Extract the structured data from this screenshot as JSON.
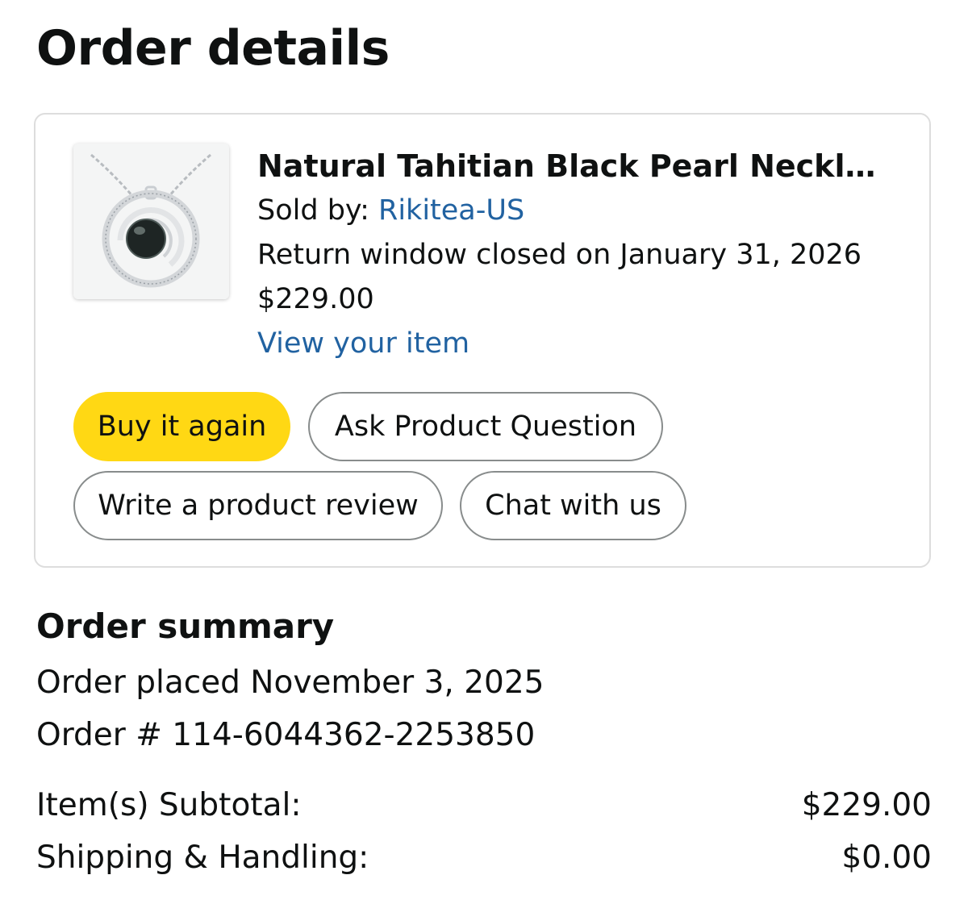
{
  "page": {
    "title": "Order details"
  },
  "item": {
    "title": "Natural Tahitian Black Pearl Necklac…",
    "sold_by_label": "Sold by:",
    "seller": "Rikitea-US",
    "return_window": "Return window closed on January 31, 2026",
    "price": "$229.00",
    "view_link": "View your item",
    "image_icon": "pearl-pendant-necklace"
  },
  "actions": {
    "buy_again": "Buy it again",
    "ask_question": "Ask Product Question",
    "write_review": "Write a product review",
    "chat": "Chat with us"
  },
  "summary": {
    "title": "Order summary",
    "placed": "Order placed November 3, 2025",
    "order_number": "Order # 114-6044362-2253850",
    "rows": [
      {
        "label": "Item(s) Subtotal:",
        "value": "$229.00"
      },
      {
        "label": "Shipping & Handling:",
        "value": "$0.00"
      }
    ]
  },
  "colors": {
    "primary_button": "#FFD814",
    "link": "#2162A1",
    "text": "#0F1111",
    "card_border": "#DDDDDD"
  }
}
